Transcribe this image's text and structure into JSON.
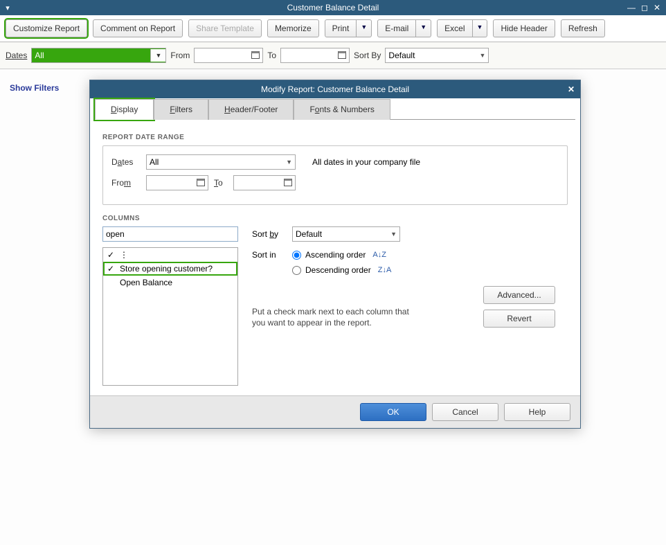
{
  "window": {
    "title": "Customer Balance Detail"
  },
  "toolbar": {
    "customize": "Customize Report",
    "comment": "Comment on Report",
    "share": "Share Template",
    "memorize": "Memorize",
    "print": "Print",
    "email": "E-mail",
    "excel": "Excel",
    "hide_header": "Hide Header",
    "refresh": "Refresh"
  },
  "filterbar": {
    "dates_label": "Dates",
    "dates_value": "All",
    "from_label": "From",
    "to_label": "To",
    "sort_by_label": "Sort By",
    "sort_by_value": "Default"
  },
  "report": {
    "show_filters": "Show Filters"
  },
  "modal": {
    "title": "Modify Report: Customer Balance Detail",
    "tabs": {
      "display": "Display",
      "filters": "Filters",
      "header_footer": "Header/Footer",
      "fonts": "Fonts & Numbers"
    },
    "date_range": {
      "section": "Report Date Range",
      "dates_label": "Dates",
      "dates_value": "All",
      "dates_hint": "All dates in your company file",
      "from_label": "From",
      "to_label": "To"
    },
    "columns": {
      "section": "Columns",
      "search_value": "open",
      "items": [
        {
          "checked": true,
          "label": "⋮"
        },
        {
          "checked": true,
          "label": "Store opening customer?"
        },
        {
          "checked": false,
          "label": "Open Balance"
        }
      ],
      "sort_by_label": "Sort by",
      "sort_by_value": "Default",
      "sort_in_label": "Sort in",
      "ascending": "Ascending order",
      "descending": "Descending order",
      "hint": "Put a check mark next to each column that you want to appear in the report.",
      "advanced": "Advanced...",
      "revert": "Revert"
    },
    "footer": {
      "ok": "OK",
      "cancel": "Cancel",
      "help": "Help"
    }
  }
}
